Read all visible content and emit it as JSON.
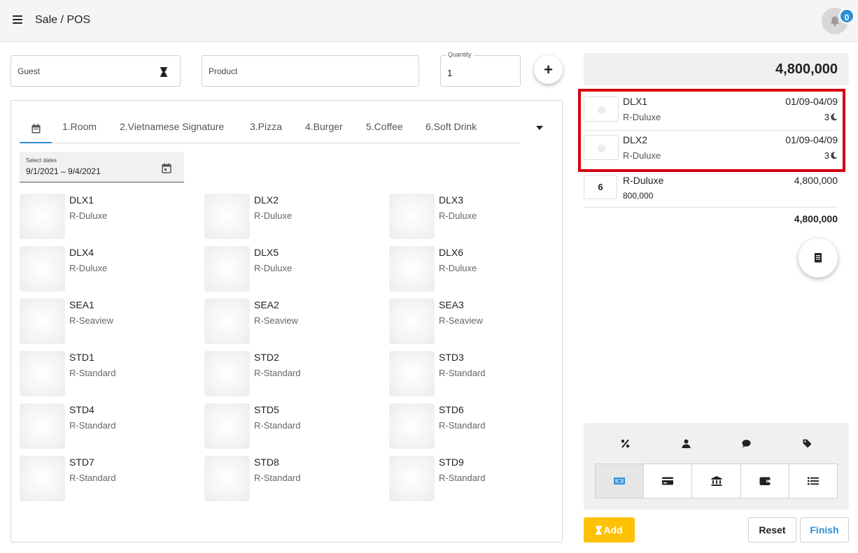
{
  "header": {
    "title": "Sale / POS",
    "notification_count": "0"
  },
  "inputs": {
    "guest_placeholder": "Guest",
    "product_placeholder": "Product",
    "quantity_label": "Quantity",
    "quantity_value": "1"
  },
  "tabs": [
    "1.Room",
    "2.Vietnamese Signature",
    "3.Pizza",
    "4.Burger",
    "5.Coffee",
    "6.Soft Drink"
  ],
  "date_range": {
    "label": "Select dates",
    "value": "9/1/2021 – 9/4/2021"
  },
  "rooms": [
    {
      "code": "DLX1",
      "type": "R-Duluxe"
    },
    {
      "code": "DLX2",
      "type": "R-Duluxe"
    },
    {
      "code": "DLX3",
      "type": "R-Duluxe"
    },
    {
      "code": "DLX4",
      "type": "R-Duluxe"
    },
    {
      "code": "DLX5",
      "type": "R-Duluxe"
    },
    {
      "code": "DLX6",
      "type": "R-Duluxe"
    },
    {
      "code": "SEA1",
      "type": "R-Seaview"
    },
    {
      "code": "SEA2",
      "type": "R-Seaview"
    },
    {
      "code": "SEA3",
      "type": "R-Seaview"
    },
    {
      "code": "STD1",
      "type": "R-Standard"
    },
    {
      "code": "STD2",
      "type": "R-Standard"
    },
    {
      "code": "STD3",
      "type": "R-Standard"
    },
    {
      "code": "STD4",
      "type": "R-Standard"
    },
    {
      "code": "STD5",
      "type": "R-Standard"
    },
    {
      "code": "STD6",
      "type": "R-Standard"
    },
    {
      "code": "STD7",
      "type": "R-Standard"
    },
    {
      "code": "STD8",
      "type": "R-Standard"
    },
    {
      "code": "STD9",
      "type": "R-Standard"
    }
  ],
  "order": {
    "total": "4,800,000",
    "lines": [
      {
        "code": "DLX1",
        "type": "R-Duluxe",
        "dates": "01/09-04/09",
        "nights": "3"
      },
      {
        "code": "DLX2",
        "type": "R-Duluxe",
        "dates": "01/09-04/09",
        "nights": "3"
      }
    ],
    "group": {
      "qty": "6",
      "name": "R-Duluxe",
      "price": "800,000",
      "amount": "4,800,000"
    },
    "subtotal": "4,800,000"
  },
  "payment": {
    "options": [
      "percent-icon",
      "user-icon",
      "comment-icon",
      "tag-icon"
    ],
    "methods": [
      "cash-icon",
      "credit-card-icon",
      "bank-icon",
      "wallet-icon",
      "list-icon"
    ],
    "active_method": "cash-icon"
  },
  "actions": {
    "add_label": "Add",
    "reset_label": "Reset",
    "finish_label": "Finish"
  },
  "colors": {
    "accent": "#2f8fd6",
    "highlight": "#d3000d",
    "add_button": "#ffc107"
  }
}
